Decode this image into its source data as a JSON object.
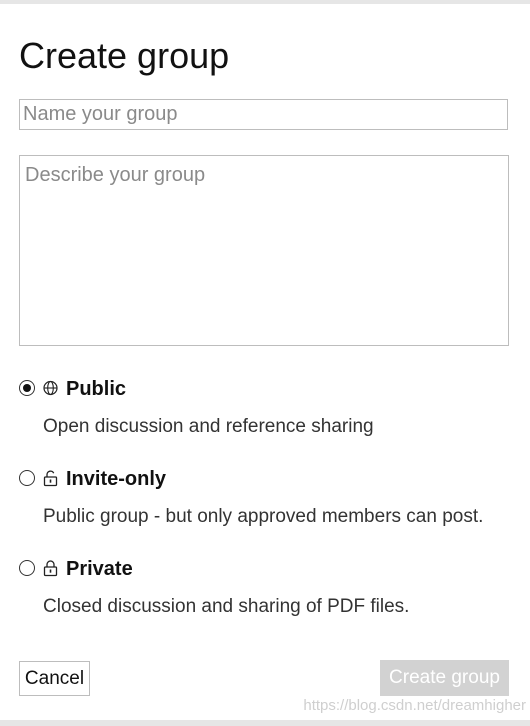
{
  "dialog": {
    "title": "Create group",
    "name_field": {
      "placeholder": "Name your group",
      "value": ""
    },
    "description_field": {
      "placeholder": "Describe your group",
      "value": ""
    },
    "privacy_options": [
      {
        "icon": "globe-icon",
        "label": "Public",
        "description": "Open discussion and reference sharing",
        "selected": true
      },
      {
        "icon": "unlocked-icon",
        "label": "Invite-only",
        "description": "Public group - but only approved members can post.",
        "selected": false
      },
      {
        "icon": "lock-icon",
        "label": "Private",
        "description": "Closed discussion and sharing of PDF files.",
        "selected": false
      }
    ],
    "cancel_label": "Cancel",
    "create_label": "Create group"
  },
  "watermark": "https://blog.csdn.net/dreamhigher",
  "colors": {
    "create_button_disabled_bg": "#d2d2d2",
    "border": "#bdbdbd",
    "text": "#111111"
  }
}
